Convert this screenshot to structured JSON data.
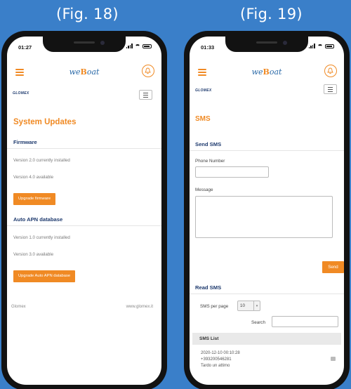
{
  "captions": {
    "left": "(Fig. 18)",
    "right": "(Fig. 19)"
  },
  "colors": {
    "background": "#3a7fc9",
    "accent": "#f08a24",
    "navy": "#1e3a6e"
  },
  "icons": [
    "hamburger-icon",
    "bell-icon",
    "menu-icon",
    "signal-icon",
    "wifi-icon",
    "battery-icon",
    "trash-icon"
  ],
  "left_phone": {
    "status_time": "01:27",
    "brand": {
      "pre": "we",
      "accent": "B",
      "post": "oat"
    },
    "logo": "GLOMEX",
    "title": "System Updates",
    "firmware": {
      "heading": "Firmware",
      "installed": "Version 2.0 currently installed",
      "available": "Version 4.0 available",
      "button": "Upgrade firmware"
    },
    "apn": {
      "heading": "Auto APN database",
      "installed": "Version 1.0 currently installed",
      "available": "Version 3.0 available",
      "button": "Upgrade Auto APN database"
    },
    "footer": {
      "left": "Glomex",
      "right": "www.glomex.it"
    }
  },
  "right_phone": {
    "status_time": "01:33",
    "brand": {
      "pre": "we",
      "accent": "B",
      "post": "oat"
    },
    "logo": "GLOMEX",
    "title": "SMS",
    "send": {
      "heading": "Send SMS",
      "phone_label": "Phone Number",
      "phone_value": "",
      "message_label": "Message",
      "message_value": "",
      "button": "Send"
    },
    "read": {
      "heading": "Read SMS",
      "per_page_label": "SMS per page",
      "per_page_value": "10",
      "search_label": "Search",
      "search_value": "",
      "list_header": "SMS List",
      "items": [
        {
          "date": "2020-12-10 00:10:28",
          "number": "+393200546281",
          "text": "Tardo un attimo"
        }
      ]
    }
  }
}
